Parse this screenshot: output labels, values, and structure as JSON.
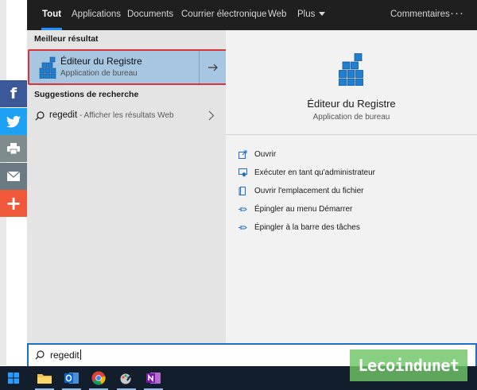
{
  "nav": {
    "tabs": [
      {
        "label": "Tout",
        "active": true
      },
      {
        "label": "Applications"
      },
      {
        "label": "Documents"
      },
      {
        "label": "Courrier électronique"
      },
      {
        "label": "Web"
      },
      {
        "label": "Plus"
      }
    ],
    "feedback": "Commentaires",
    "more": "···"
  },
  "left": {
    "best_match_heading": "Meilleur résultat",
    "best_match": {
      "title": "Éditeur du Registre",
      "subtitle": "Application de bureau"
    },
    "suggestions_heading": "Suggestions de recherche",
    "suggestion": {
      "query": "regedit",
      "hint": " - Afficher les résultats Web"
    }
  },
  "right": {
    "title": "Éditeur du Registre",
    "subtitle": "Application de bureau",
    "actions": [
      {
        "label": "Ouvrir",
        "icon": "open-icon"
      },
      {
        "label": "Exécuter en tant qu'administrateur",
        "icon": "run-as-admin-icon"
      },
      {
        "label": "Ouvrir l'emplacement du fichier",
        "icon": "file-location-icon"
      },
      {
        "label": "Épingler au menu Démarrer",
        "icon": "pin-icon"
      },
      {
        "label": "Épingler à la barre des tâches",
        "icon": "pin-icon"
      }
    ]
  },
  "search": {
    "value": "regedit"
  },
  "social": [
    "f",
    "twitter",
    "print",
    "email",
    "+"
  ],
  "taskbar": {
    "apps": [
      "file-explorer",
      "outlook",
      "chrome",
      "paint-app",
      "onenote"
    ]
  },
  "watermark": "Lecoindunet",
  "colors": {
    "accent": "#1e6fc8",
    "selection": "#a7c6e2",
    "highlight_border": "#d9343a",
    "topbar": "#1f1f1f",
    "taskbar": "#121e2c",
    "watermark": "#6ec466"
  }
}
